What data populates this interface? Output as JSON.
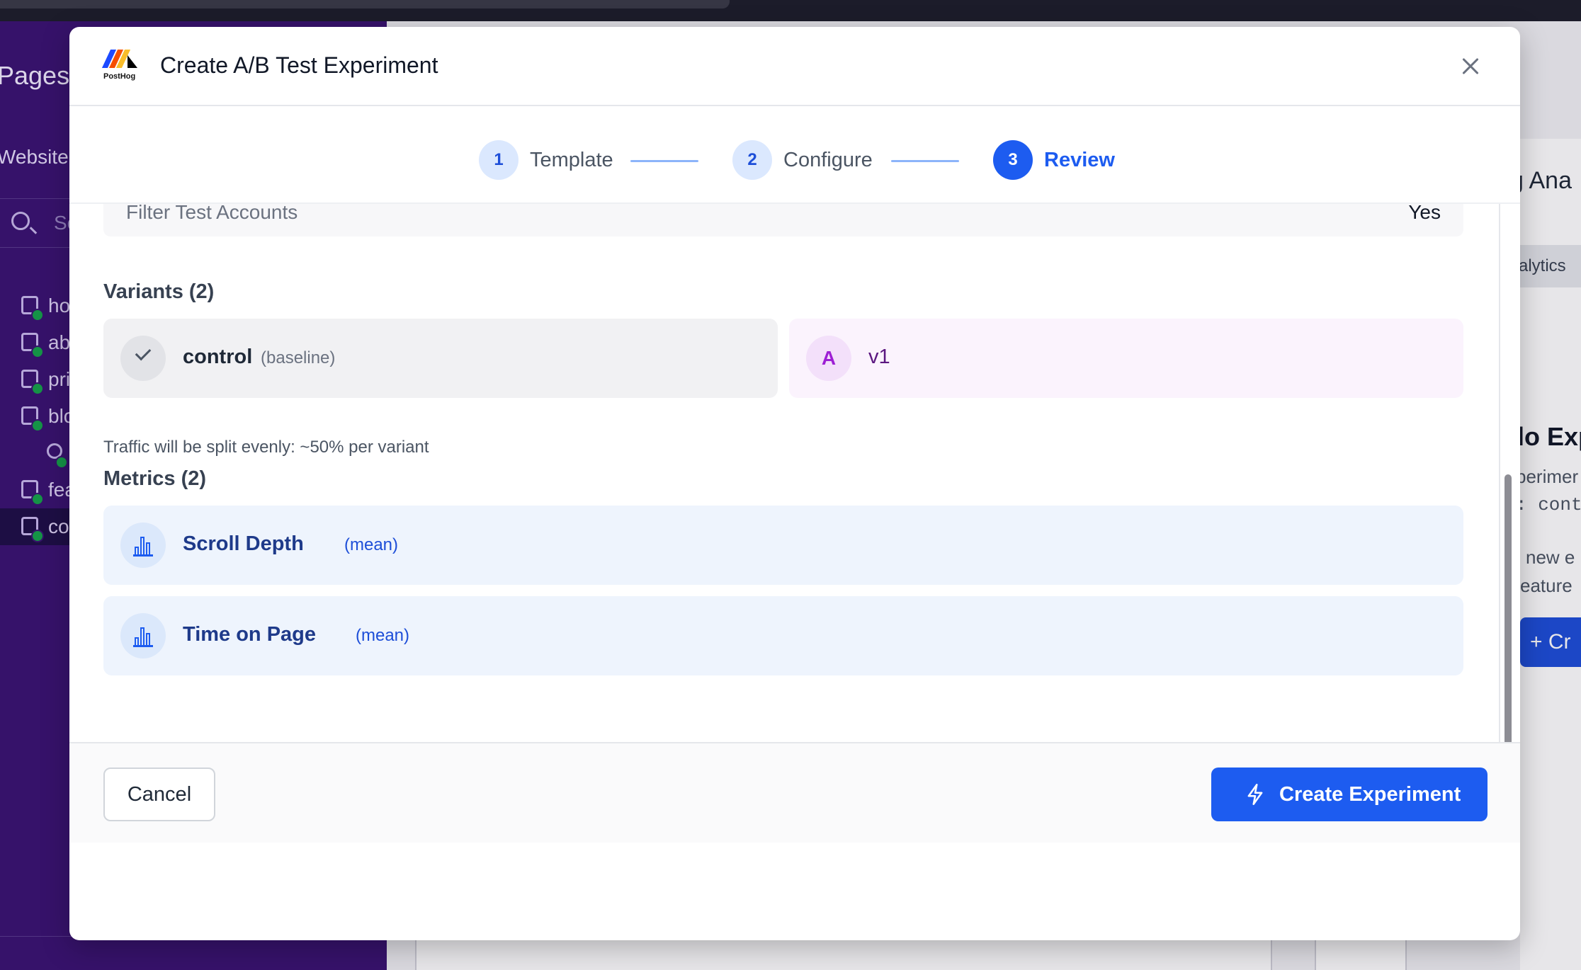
{
  "background": {
    "sidebar": {
      "title": "Pages",
      "site": "Website",
      "search_placeholder": "Se",
      "items": [
        {
          "label": "ho"
        },
        {
          "label": "ab"
        },
        {
          "label": "pri"
        },
        {
          "label": "blo"
        },
        {
          "label": ""
        },
        {
          "label": "fea"
        },
        {
          "label": "co"
        }
      ]
    },
    "right_panel": {
      "heading": "g Ana",
      "tab": "alytics",
      "empty_title": "lo Exp",
      "empty_text_1": "perimer",
      "empty_text_2": ": cont",
      "empty_text_3": "new e",
      "empty_text_4": "eature",
      "create_label": "+ Cr"
    }
  },
  "modal": {
    "title": "Create A/B Test Experiment",
    "logo_text": "PostHog",
    "steps": [
      {
        "number": "1",
        "label": "Template",
        "state": "done"
      },
      {
        "number": "2",
        "label": "Configure",
        "state": "done"
      },
      {
        "number": "3",
        "label": "Review",
        "state": "active"
      }
    ],
    "summary_row": {
      "key": "Filter Test Accounts",
      "value": "Yes"
    },
    "variants": {
      "heading": "Variants (2)",
      "items": [
        {
          "name": "control",
          "tag": "(baseline)",
          "badge": "check-icon"
        },
        {
          "name": "v1",
          "tag": "",
          "badge": "A"
        }
      ],
      "split_note": "Traffic will be split evenly: ~50% per variant"
    },
    "metrics": {
      "heading": "Metrics (2)",
      "items": [
        {
          "name": "Scroll Depth",
          "tag": "(mean)"
        },
        {
          "name": "Time on Page",
          "tag": "(mean)"
        }
      ]
    },
    "footer": {
      "cancel_label": "Cancel",
      "create_label": "Create Experiment"
    }
  },
  "colors": {
    "accent": "#1d5cf0",
    "sidebar": "#3a1472",
    "variant_accent": "#9d1fd4",
    "success_dot": "#16a34a"
  }
}
